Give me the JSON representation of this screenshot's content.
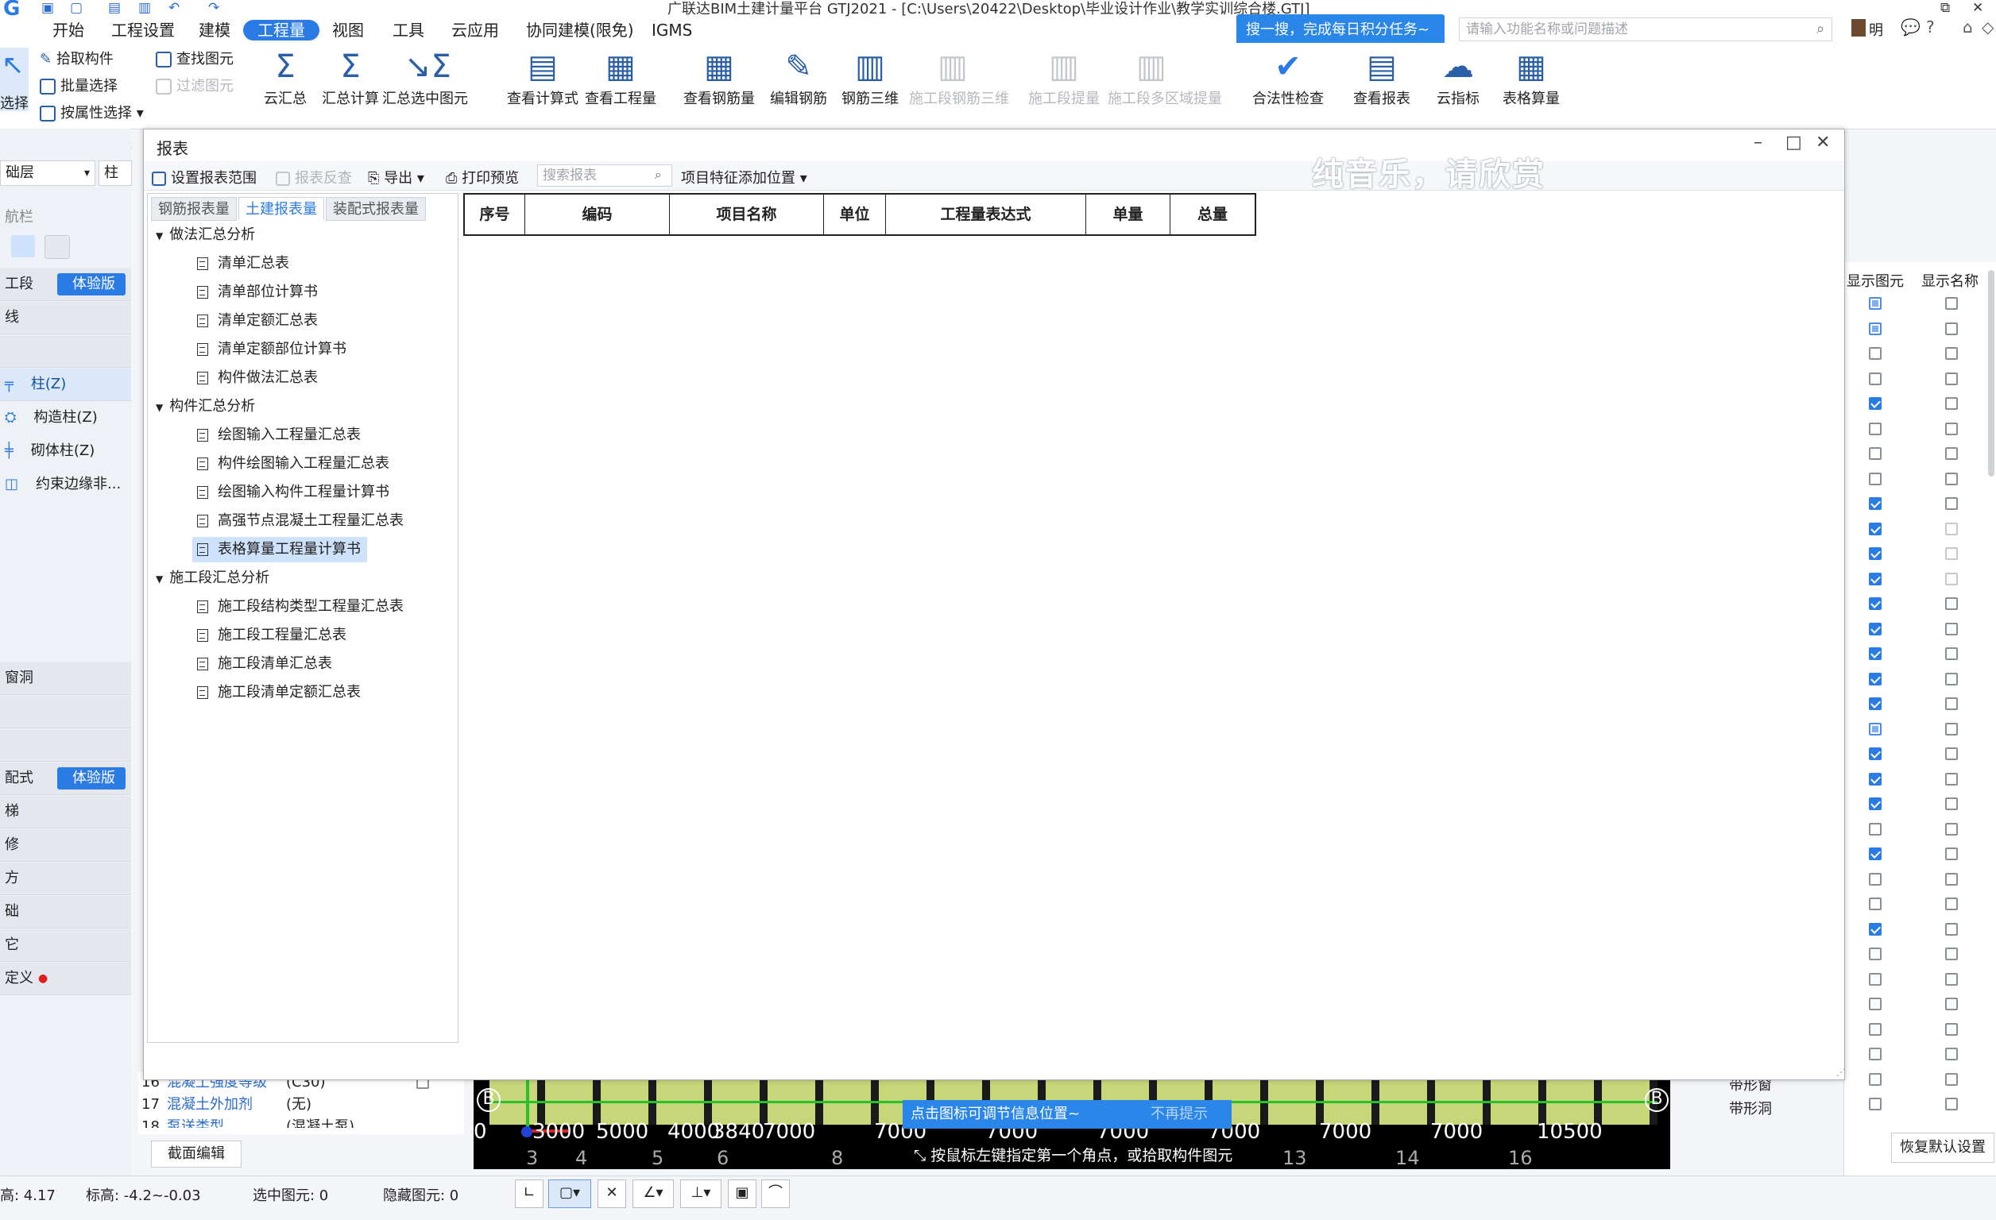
{
  "title_bar": {
    "title": "广联达BIM土建计量平台 GTJ2021 - [C:\\Users\\20422\\Desktop\\毕业设计作业\\教学实训综合楼.GTJ]"
  },
  "menu": {
    "items": [
      "开始",
      "工程设置",
      "建模",
      "工程量",
      "视图",
      "工具",
      "云应用",
      "协同建模(限免)",
      "IGMS"
    ],
    "active_index": 3
  },
  "search": {
    "tip": "搜一搜，完成每日积分任务~",
    "placeholder": "请输入功能名称或问题描述",
    "user": "明"
  },
  "ribbon": {
    "select_group": {
      "pick": "拾取构件",
      "batch": "批量选择",
      "by_attr": "按属性选择",
      "find": "查找图元",
      "filter": "过滤图元",
      "label": "选择",
      "select_big": "选择"
    },
    "buttons": [
      {
        "label": "云汇总",
        "enabled": true
      },
      {
        "label": "汇总计算",
        "enabled": true
      },
      {
        "label": "汇总选中图元",
        "enabled": true
      },
      {
        "label": "查看计算式",
        "enabled": true
      },
      {
        "label": "查看工程量",
        "enabled": true
      },
      {
        "label": "查看钢筋量",
        "enabled": true
      },
      {
        "label": "编辑钢筋",
        "enabled": true
      },
      {
        "label": "钢筋三维",
        "enabled": true
      },
      {
        "label": "施工段钢筋三维",
        "enabled": false
      },
      {
        "label": "施工段提量",
        "enabled": false
      },
      {
        "label": "施工段多区域提量",
        "enabled": false
      },
      {
        "label": "合法性检查",
        "enabled": true
      },
      {
        "label": "查看报表",
        "enabled": true
      },
      {
        "label": "云指标",
        "enabled": true
      },
      {
        "label": "表格算量",
        "enabled": true
      }
    ]
  },
  "left_panel": {
    "floor": "础层",
    "category": "柱",
    "nav_label": "航栏",
    "section1": "工段",
    "badge": "体验版",
    "line": "线",
    "items": [
      "柱(Z)",
      "构造柱(Z)",
      "砌体柱(Z)",
      "约束边缘非..."
    ],
    "door": "窗洞",
    "section2": "配式",
    "small": [
      "梯",
      "修",
      "方",
      "础",
      "它",
      "定义"
    ]
  },
  "dialog": {
    "title": "报表",
    "toolbar": {
      "set_range": "设置报表范围",
      "reverse": "报表反查",
      "export": "导出",
      "print": "打印预览",
      "search_placeholder": "搜索报表",
      "feature_pos": "项目特征添加位置"
    },
    "watermark": "纯音乐，请欣赏",
    "tabs": [
      "钢筋报表量",
      "土建报表量",
      "装配式报表量"
    ],
    "active_tab": 1,
    "tree": [
      {
        "group": "做法汇总分析",
        "items": [
          "清单汇总表",
          "清单部位计算书",
          "清单定额汇总表",
          "清单定额部位计算书",
          "构件做法汇总表"
        ]
      },
      {
        "group": "构件汇总分析",
        "items": [
          "绘图输入工程量汇总表",
          "构件绘图输入工程量汇总表",
          "绘图输入构件工程量计算书",
          "高强节点混凝土工程量汇总表",
          "表格算量工程量计算书"
        ]
      },
      {
        "group": "施工段汇总分析",
        "items": [
          "施工段结构类型工程量汇总表",
          "施工段工程量汇总表",
          "施工段清单汇总表",
          "施工段清单定额汇总表"
        ]
      }
    ],
    "selected_item": "表格算量工程量计算书",
    "table_headers": [
      "序号",
      "编码",
      "项目名称",
      "单位",
      "工程量表达式",
      "单量",
      "总量"
    ]
  },
  "right_panel": {
    "headers": [
      "显示图元",
      "显示名称"
    ],
    "show_states": [
      "part",
      "part",
      "off",
      "off",
      "on",
      "off",
      "off",
      "off",
      "on",
      "on",
      "on",
      "on",
      "on",
      "on",
      "on",
      "on",
      "on",
      "part",
      "on",
      "on",
      "on",
      "off",
      "on",
      "off",
      "off",
      "on",
      "off",
      "off",
      "off",
      "off",
      "off",
      "off",
      "off"
    ],
    "name_states": [
      "off",
      "off",
      "off",
      "off",
      "off",
      "off",
      "off",
      "off",
      "off",
      "dim",
      "dim",
      "dim",
      "off",
      "off",
      "off",
      "off",
      "off",
      "off",
      "off",
      "off",
      "off",
      "off",
      "off",
      "off",
      "off",
      "off",
      "off",
      "off",
      "off",
      "off",
      "off",
      "off",
      "off"
    ],
    "bottom_items": [
      "带形窗",
      "带形洞"
    ],
    "restore": "恢复默认设置"
  },
  "props": {
    "rows": [
      {
        "no": "16",
        "name": "混凝土强度等级",
        "value": "(C30)"
      },
      {
        "no": "17",
        "name": "混凝土外加剂",
        "value": "(无)"
      },
      {
        "no": "18",
        "name": "泵送类型",
        "value": "(混凝土泵)"
      }
    ],
    "section_edit": "截面编辑"
  },
  "canvas": {
    "tip": "点击图标可调节信息位置~",
    "tip_dismiss": "不再提示",
    "hint": "按鼠标左键指定第一个角点，或拾取构件图元",
    "dims": [
      "0",
      "3000",
      "5000",
      "4000",
      "3840",
      "7000",
      "7000",
      "7000",
      "7000",
      "7000",
      "7000",
      "7000",
      "10500"
    ],
    "axes": [
      "3",
      "4",
      "5",
      "6",
      "8",
      "13",
      "14",
      "16"
    ],
    "axis_letter": "B"
  },
  "status": {
    "height": "高: 4.17",
    "elevation": "标高:  -4.2~-0.03",
    "selected": "选中图元: 0",
    "hidden": "隐藏图元: 0"
  }
}
